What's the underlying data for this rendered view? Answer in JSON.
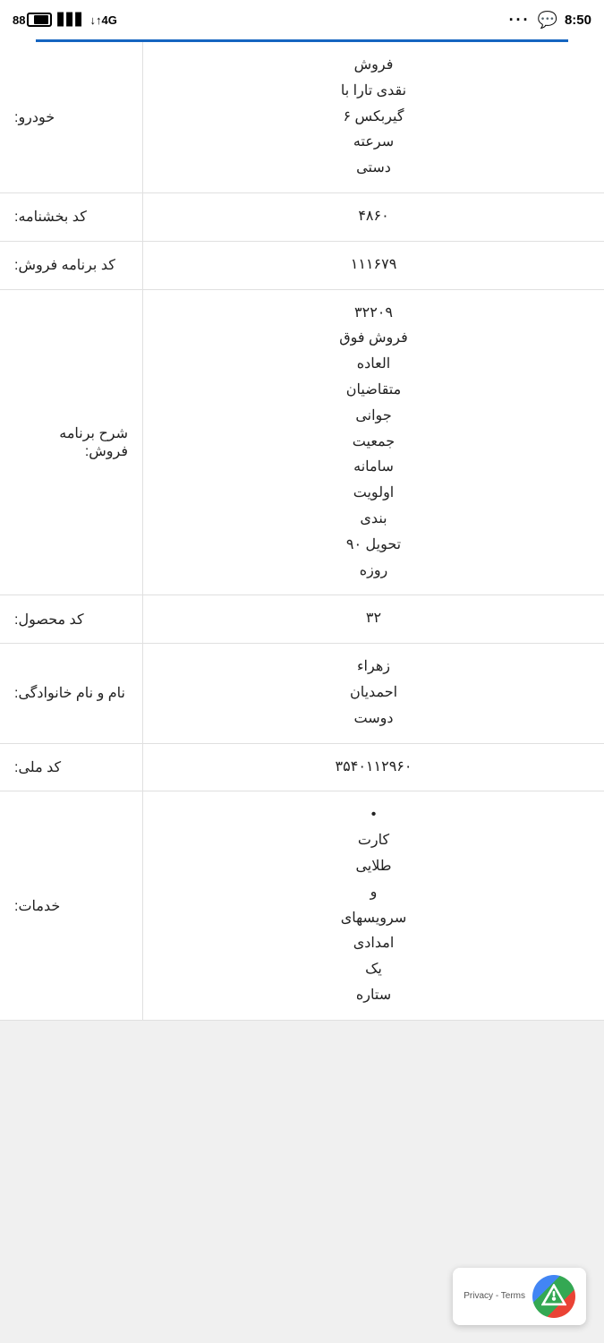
{
  "statusBar": {
    "time": "8:50",
    "network": "4G",
    "battery": "88"
  },
  "rows": [
    {
      "label": "خودرو:",
      "value": "فروش\nنقدی تارا با\nگیربکس ۶\nسرعته\nدستی",
      "multiline": true
    },
    {
      "label": "کد بخشنامه:",
      "value": "۴۸۶۰",
      "multiline": false
    },
    {
      "label": "کد برنامه فروش:",
      "value": "۱۱۱۶۷۹",
      "multiline": false
    },
    {
      "label": "شرح برنامه فروش:",
      "value": "۳۲۲۰۹\nفروش فوق\nالعاده\nمتقاضیان\nجوانی\nجمعیت\nسامانه\nاولویت\nبندی\nتحویل ۹۰\nروزه",
      "multiline": true
    },
    {
      "label": "کد محصول:",
      "value": "۳۲",
      "multiline": false
    },
    {
      "label": "نام و نام خانوادگی:",
      "value": "زهراء\nاحمدیان\nدوست",
      "multiline": true
    },
    {
      "label": "کد ملی:",
      "value": "۳۵۴۰۱۱۲۹۶۰",
      "multiline": false
    },
    {
      "label": "خدمات:",
      "value": "•\nکارت\nطلایی\nو\nسرویسهای\nامدادی\nیک\nستاره",
      "multiline": true
    }
  ],
  "footer": {
    "privacyText": "Privacy",
    "separator": "-",
    "termsText": "Terms"
  }
}
